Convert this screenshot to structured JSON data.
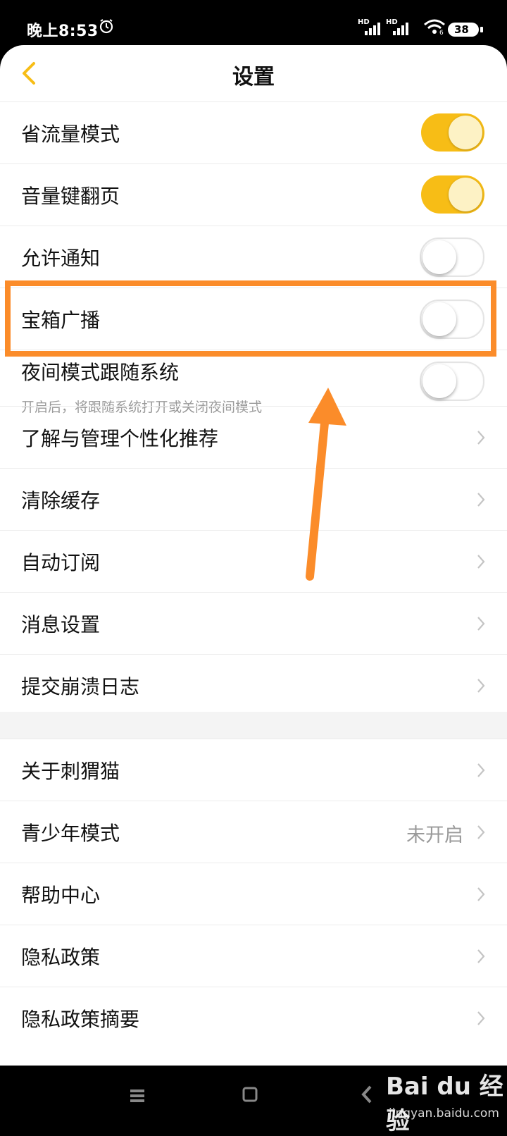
{
  "status_bar": {
    "time": "晚上8:53",
    "signal1_label": "HD",
    "signal2_label": "HD",
    "wifi_label": "6",
    "battery": "38"
  },
  "header": {
    "title": "设置"
  },
  "toggles": [
    {
      "label": "省流量模式",
      "on": true
    },
    {
      "label": "音量键翻页",
      "on": true
    },
    {
      "label": "允许通知",
      "on": false
    },
    {
      "label": "宝箱广播",
      "on": false
    },
    {
      "label": "夜间模式跟随系统",
      "sub": "开启后，将跟随系统打开或关闭夜间模式",
      "on": false
    }
  ],
  "links": [
    {
      "label": "了解与管理个性化推荐"
    },
    {
      "label": "清除缓存"
    },
    {
      "label": "自动订阅"
    },
    {
      "label": "消息设置"
    },
    {
      "label": "提交崩溃日志"
    }
  ],
  "links2": [
    {
      "label": "关于刺猬猫"
    },
    {
      "label": "青少年模式",
      "value": "未开启"
    },
    {
      "label": "帮助中心"
    },
    {
      "label": "隐私政策"
    },
    {
      "label": "隐私政策摘要"
    }
  ],
  "colors": {
    "accent": "#f7bd16",
    "highlight": "#fb8c2a"
  },
  "watermark": {
    "logo": "Bai du 经验",
    "url": "jingyan.baidu.com"
  }
}
